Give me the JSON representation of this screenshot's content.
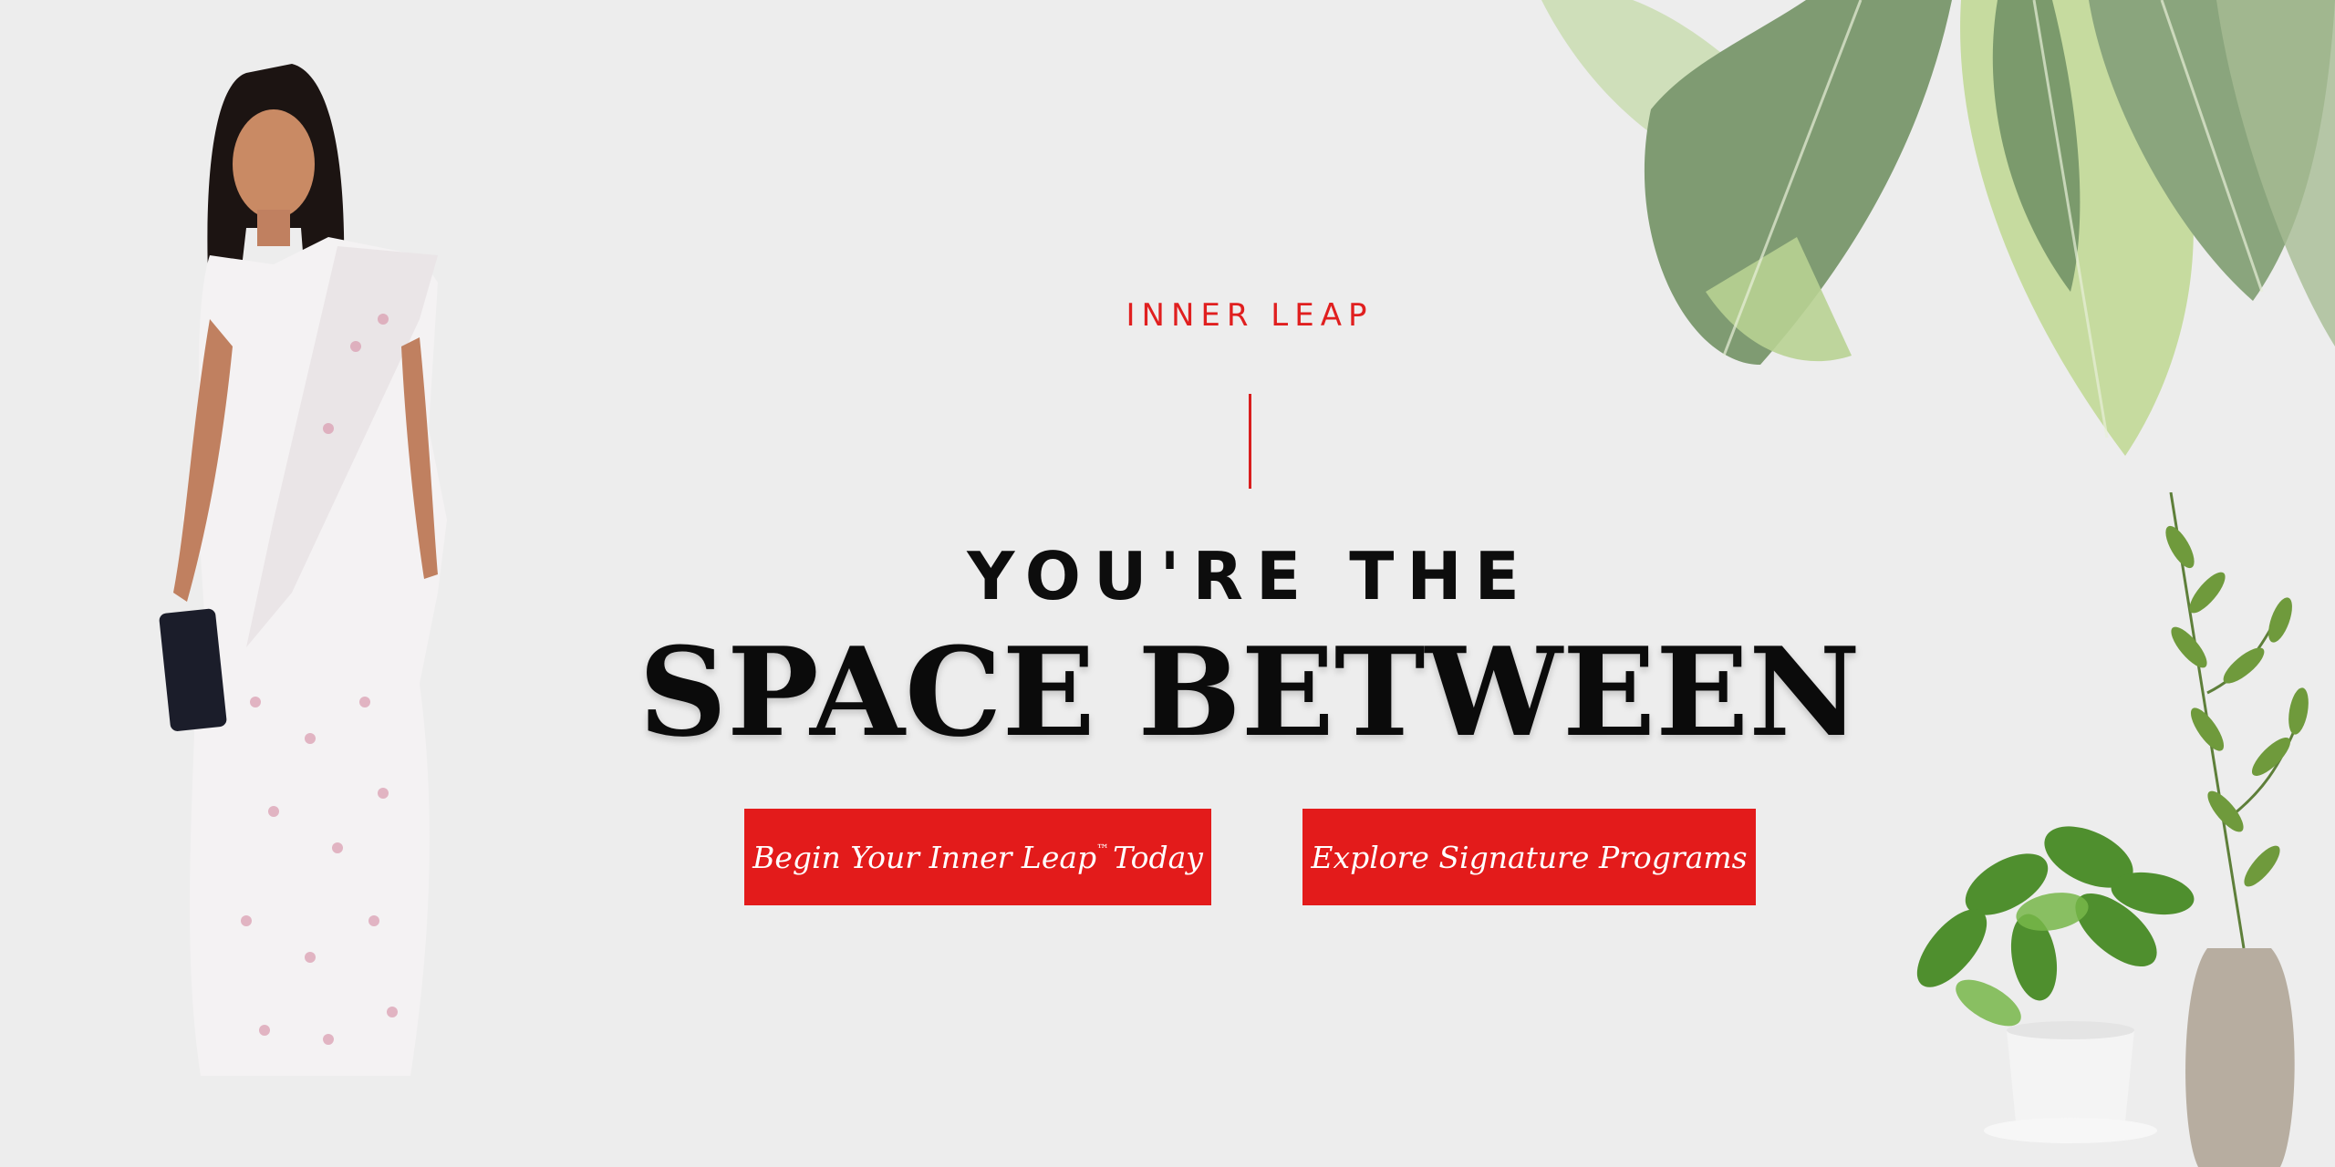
{
  "hero": {
    "eyebrow": "INNER LEAP",
    "headline_top": "YOU'RE THE",
    "headline_main": "SPACE BETWEEN"
  },
  "buttons": {
    "primary_label_part1": "Begin Your Inner Leap",
    "primary_trademark": "™",
    "primary_label_part2": "Today",
    "secondary_label": "Explore Signature Programs"
  },
  "colors": {
    "background": "#ededed",
    "accent_red": "#e31b1b",
    "text_dark": "#0b0b0b"
  },
  "images": {
    "portrait": "woman-in-white-saree-portrait",
    "leaves": "green-leaves-decoration",
    "plants": "potted-plants-decoration"
  }
}
